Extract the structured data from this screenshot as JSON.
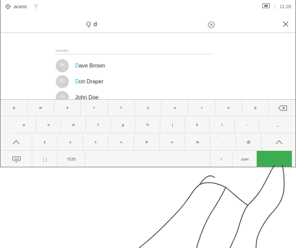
{
  "status": {
    "brand": "acano",
    "time": "11:28"
  },
  "search": {
    "prefix": "Q",
    "value": "d",
    "placeholder": ""
  },
  "favorites": {
    "label": "Favorites",
    "contacts": [
      {
        "initials": "DB",
        "highlight": "D",
        "rest": "ave Brown"
      },
      {
        "initials": "DD",
        "highlight": "D",
        "rest": "on Draper"
      },
      {
        "initials": "JD",
        "highlight": "",
        "rest": "John Doe"
      }
    ]
  },
  "keyboard": {
    "row1": [
      "q",
      "w",
      "e",
      "r",
      "t",
      "y",
      "u",
      "i",
      "o",
      "p"
    ],
    "row2": [
      "a",
      "s",
      "d",
      "f",
      "g",
      "h",
      "j",
      "k",
      "l",
      "-",
      "_"
    ],
    "row3": [
      "z",
      "x",
      "c",
      "v",
      "b",
      "n",
      "m",
      ".",
      "@"
    ],
    "numbers_key": "?123",
    "slash_key": "/",
    "dotcom_key": ".com"
  },
  "colors": {
    "accent": "#28a8d8",
    "enter": "#3cae4f",
    "avatar": "#d2d2d2"
  }
}
